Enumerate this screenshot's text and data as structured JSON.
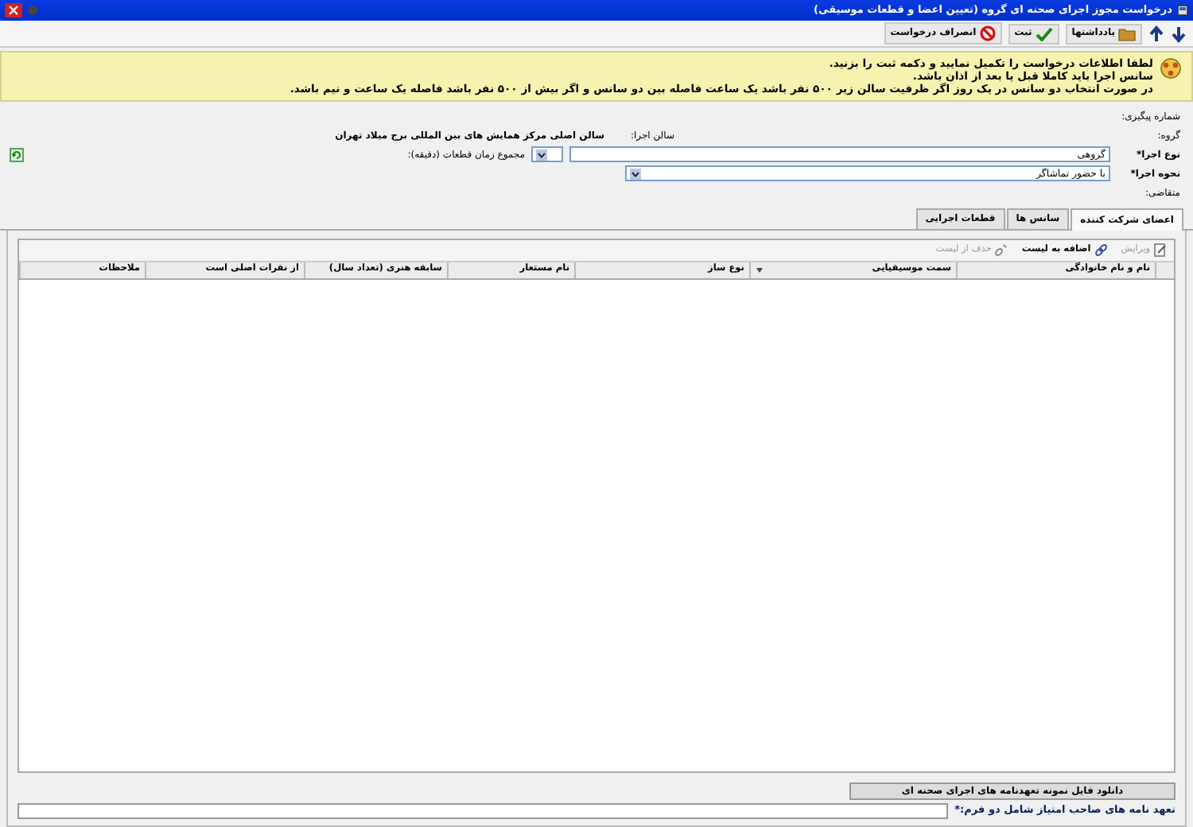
{
  "window": {
    "title": "درخواست مجوز اجرای صحنه ای گروه (تعیین اعضا و قطعات موسیقی)"
  },
  "toolbar": [
    {
      "kind": "down"
    },
    {
      "kind": "up"
    },
    {
      "kind": "notes",
      "label": "یادداشتها"
    },
    {
      "kind": "save",
      "label": "ثبت"
    },
    {
      "kind": "cancel",
      "label": "انصراف درخواست"
    }
  ],
  "notice": [
    "لطفا اطلاعات درخواست را تکمیل نمایید و دکمه ثبت را بزنید.",
    "سانس اجرا باید کاملا قبل یا بعد از اذان باشد.",
    "در صورت انتخاب دو سانس در یک روز اگر ظرفیت سالن زیر ۵۰۰ نفر باشد یک ساعت فاصله بین دو سانس و اگر بیش از ۵۰۰ نفر باشد فاصله یک ساعت و نیم باشد."
  ],
  "form": {
    "tracking_label": "شماره پیگیری:",
    "group_label": "گروه:",
    "hall_label": "سالن اجرا:",
    "hall_value": "سالن اصلی مرکز همایش های بین المللی برج میلاد تهران",
    "type_label": "نوع اجرا*",
    "type_value": "گروهی",
    "duration_label": "مجموع زمان قطعات (دقیقه):",
    "method_label": "نحوه اجرا*",
    "method_value": "با حضور تماشاگر",
    "applicant_label": "متقاضی:"
  },
  "tabs": [
    {
      "label": "اعضای شرکت کننده",
      "selected": true
    },
    {
      "label": "سانس ها",
      "selected": false
    },
    {
      "label": "قطعات اجرایی",
      "selected": false
    }
  ],
  "grid_toolbar": [
    {
      "kind": "edit",
      "label": "ویرایش",
      "disabled": true
    },
    {
      "kind": "add",
      "label": "اضافه به لیست",
      "disabled": false
    },
    {
      "kind": "remove",
      "label": "حذف از لیست",
      "disabled": true
    }
  ],
  "columns": [
    {
      "label": "نام و نام خانوادگی",
      "sorted": false
    },
    {
      "label": "سمت موسیقیایی",
      "sorted": true
    },
    {
      "label": "نوع ساز",
      "sorted": false
    },
    {
      "label": "نام مستعار",
      "sorted": false
    },
    {
      "label": "سابقه هنری (تعداد سال)",
      "sorted": false
    },
    {
      "label": "از نفرات اصلی است",
      "sorted": false
    },
    {
      "label": "ملاحظات",
      "sorted": false
    }
  ],
  "download_button": "دانلود فایل نمونه تعهدنامه های اجرای صحنه ای",
  "pledge_label": "تعهد نامه های صاحب امتیاز شامل دو فرم:*"
}
